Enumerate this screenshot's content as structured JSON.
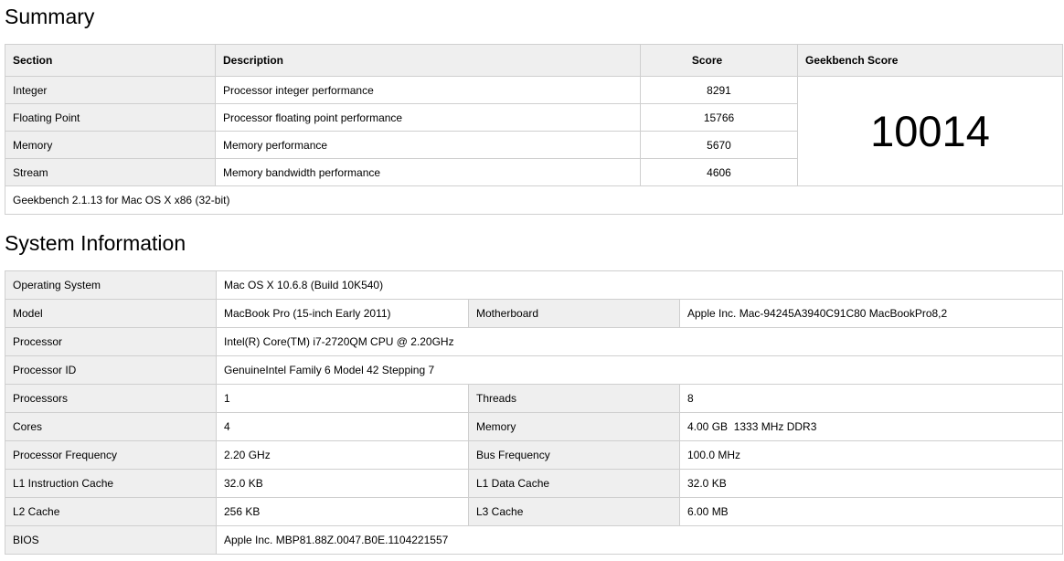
{
  "summary": {
    "heading": "Summary",
    "columns": {
      "section": "Section",
      "description": "Description",
      "score": "Score",
      "geekbench_score": "Geekbench Score"
    },
    "rows": [
      {
        "section": "Integer",
        "description": "Processor integer performance",
        "score": "8291"
      },
      {
        "section": "Floating Point",
        "description": "Processor floating point performance",
        "score": "15766"
      },
      {
        "section": "Memory",
        "description": "Memory performance",
        "score": "5670"
      },
      {
        "section": "Stream",
        "description": "Memory bandwidth performance",
        "score": "4606"
      }
    ],
    "total_score": "10014",
    "footer": "Geekbench 2.1.13 for Mac OS X x86 (32-bit)"
  },
  "system": {
    "heading": "System Information",
    "operating_system": {
      "label": "Operating System",
      "value": "Mac OS X 10.6.8 (Build 10K540)"
    },
    "model": {
      "label": "Model",
      "value": "MacBook Pro (15-inch Early 2011)"
    },
    "motherboard": {
      "label": "Motherboard",
      "value": "Apple Inc. Mac-94245A3940C91C80 MacBookPro8,2"
    },
    "processor": {
      "label": "Processor",
      "value": "Intel(R) Core(TM) i7-2720QM CPU @ 2.20GHz"
    },
    "processor_id": {
      "label": "Processor ID",
      "value": "GenuineIntel Family 6 Model 42 Stepping 7"
    },
    "processors": {
      "label": "Processors",
      "value": "1"
    },
    "threads": {
      "label": "Threads",
      "value": "8"
    },
    "cores": {
      "label": "Cores",
      "value": "4"
    },
    "memory": {
      "label": "Memory",
      "value": "4.00 GB  1333 MHz DDR3"
    },
    "processor_frequency": {
      "label": "Processor Frequency",
      "value": "2.20 GHz"
    },
    "bus_frequency": {
      "label": "Bus Frequency",
      "value": "100.0 MHz"
    },
    "l1_instruction_cache": {
      "label": "L1 Instruction Cache",
      "value": "32.0 KB"
    },
    "l1_data_cache": {
      "label": "L1 Data Cache",
      "value": "32.0 KB"
    },
    "l2_cache": {
      "label": "L2 Cache",
      "value": "256 KB"
    },
    "l3_cache": {
      "label": "L3 Cache",
      "value": "6.00 MB"
    },
    "bios": {
      "label": "BIOS",
      "value": "Apple Inc. MBP81.88Z.0047.B0E.1104221557"
    }
  }
}
